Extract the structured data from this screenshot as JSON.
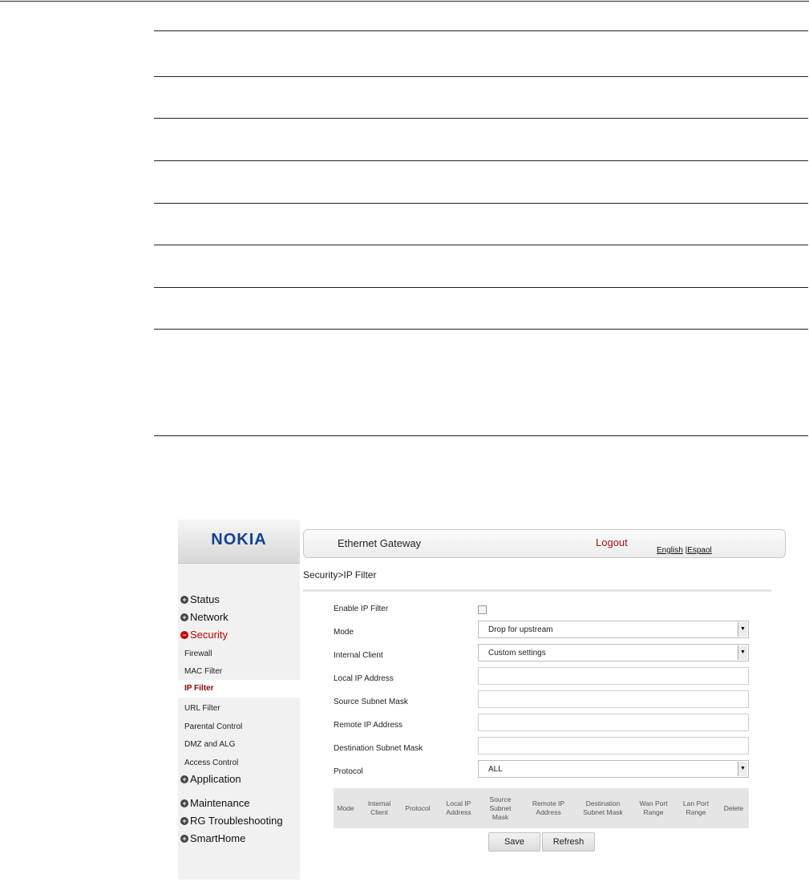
{
  "header": {
    "logo": "NOKIA",
    "title": "Ethernet Gateway",
    "logout": "Logout",
    "lang_english": "English",
    "lang_sep": " |",
    "lang_espanol": "Espaol"
  },
  "breadcrumb": "Security>IP Filter",
  "sidebar": {
    "top_items": [
      "Status",
      "Network",
      "Security"
    ],
    "security_items": [
      "Firewall",
      "MAC Filter",
      "IP Filter",
      "URL Filter",
      "Parental Control",
      "DMZ and ALG",
      "Access Control"
    ],
    "bottom_items": [
      "Application",
      "Maintenance",
      "RG Troubleshooting",
      "SmartHome"
    ]
  },
  "form": {
    "enable_label": "Enable IP Filter",
    "enable_checked": false,
    "mode_label": "Mode",
    "mode_value": "Drop for upstream",
    "internal_client_label": "Internal Client",
    "internal_client_value": "Custom settings",
    "local_ip_label": "Local IP Address",
    "local_ip_value": "",
    "source_mask_label": "Source Subnet Mask",
    "source_mask_value": "",
    "remote_ip_label": "Remote IP Address",
    "remote_ip_value": "",
    "dest_mask_label": "Destination Subnet Mask",
    "dest_mask_value": "",
    "protocol_label": "Protocol",
    "protocol_value": "ALL"
  },
  "table": {
    "headers": [
      "Mode",
      "Internal Client",
      "Protocol",
      "Local IP Address",
      "Source Subnet Mask",
      "Remote IP Address",
      "Destination Subnet Mask",
      "Wan Port Range",
      "Lan Port Range",
      "Delete"
    ]
  },
  "buttons": {
    "save": "Save",
    "refresh": "Refresh"
  },
  "colors": {
    "accent_red": "#c00000",
    "brand_blue": "#124191",
    "active_sub": "#8b0000"
  }
}
